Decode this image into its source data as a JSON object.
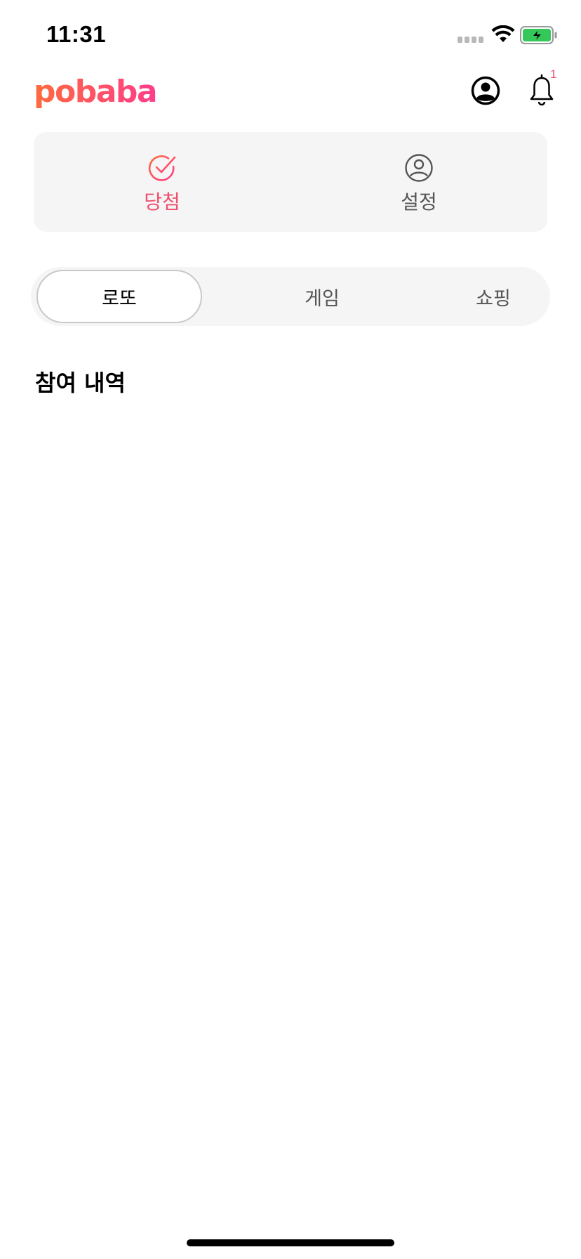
{
  "status_bar": {
    "time": "11:31",
    "icons": [
      "cellular-signal-icon",
      "wifi-icon",
      "battery-charging-icon"
    ],
    "battery_color": "#34c759"
  },
  "header": {
    "logo_text": "pobaba",
    "profile_icon": "profile-icon",
    "bell_icon": "bell-icon",
    "notification_count": "1"
  },
  "top_card": {
    "items": [
      {
        "label": "당첨",
        "icon": "check-circle-icon",
        "active": true
      },
      {
        "label": "설정",
        "icon": "user-circle-icon",
        "active": false
      }
    ]
  },
  "tabs": [
    {
      "label": "로또",
      "active": true
    },
    {
      "label": "게임",
      "active": false
    },
    {
      "label": "쇼핑",
      "active": false
    }
  ],
  "section": {
    "title": "참여 내역"
  },
  "colors": {
    "brand_gradient_start": "#ff6a3d",
    "brand_gradient_end": "#ff3d8b",
    "accent": "#f0506e",
    "card_bg": "#f5f5f5"
  }
}
